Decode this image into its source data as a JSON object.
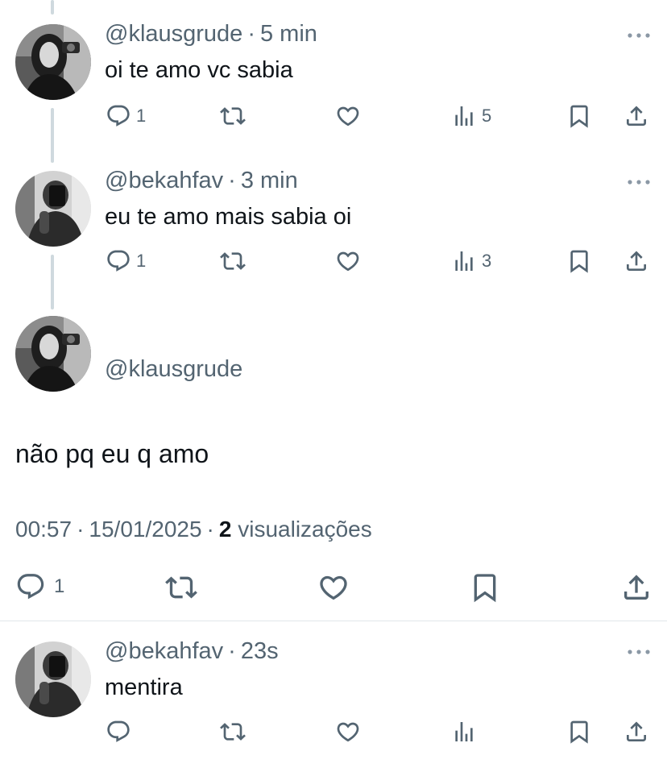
{
  "tweets": [
    {
      "handle": "@klausgrude",
      "time": "5 min",
      "text": "oi te amo vc sabia",
      "replies": "1",
      "views": "5"
    },
    {
      "handle": "@bekahfav",
      "time": "3 min",
      "text": "eu te amo mais sabia oi",
      "replies": "1",
      "views": "3"
    }
  ],
  "main_tweet": {
    "handle": "@klausgrude",
    "text": "não pq eu q amo",
    "time": "00:57",
    "date": "15/01/2025",
    "views_count": "2",
    "views_label": "visualizações",
    "replies": "1"
  },
  "reply": {
    "handle": "@bekahfav",
    "time": "23s",
    "text": "mentira"
  },
  "separator": "·",
  "icons": [
    "reply-icon",
    "retweet-icon",
    "like-icon",
    "views-icon",
    "bookmark-icon",
    "share-icon",
    "more-icon"
  ],
  "colors": {
    "text": "#0f1419",
    "secondary": "#536471",
    "thread_line": "#cfd9de",
    "divider": "#e1e6ea"
  }
}
